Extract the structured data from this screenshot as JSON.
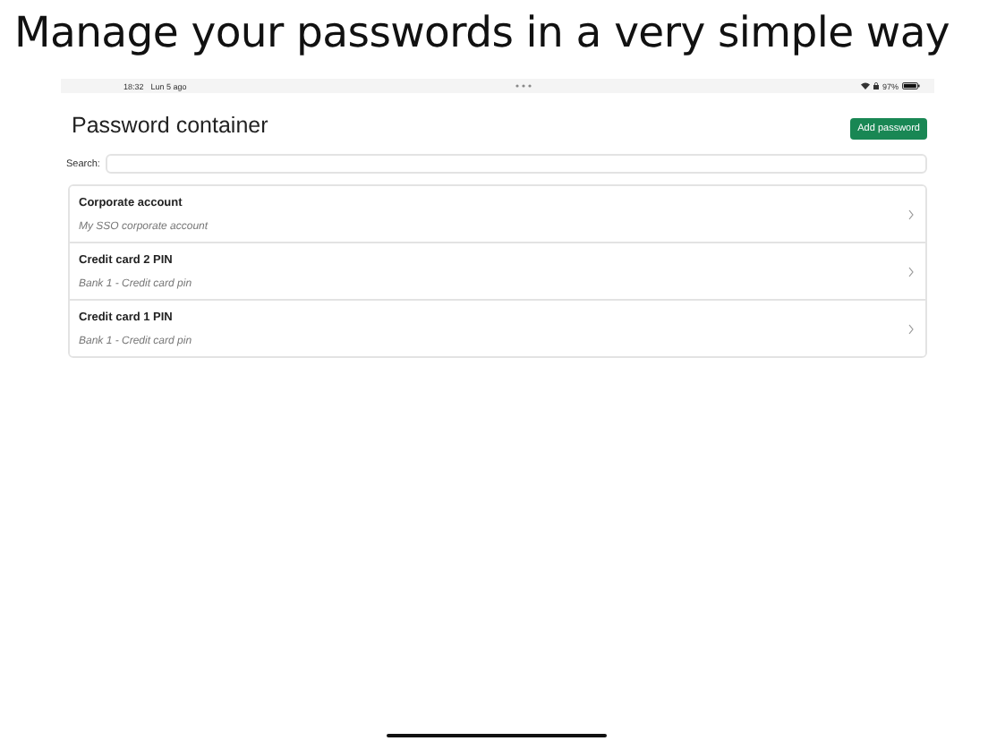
{
  "headline": "Manage your passwords in a very simple way",
  "status_bar": {
    "time": "18:32",
    "date": "Lun 5 ago",
    "battery": "97%"
  },
  "title": "Password container",
  "add_button": "Add password",
  "search": {
    "label": "Search:"
  },
  "entries": [
    {
      "name": "Corporate account",
      "description": "My SSO corporate account"
    },
    {
      "name": "Credit card 2 PIN",
      "description": "Bank 1 - Credit card pin"
    },
    {
      "name": "Credit card 1 PIN",
      "description": "Bank 1 - Credit card pin"
    }
  ]
}
